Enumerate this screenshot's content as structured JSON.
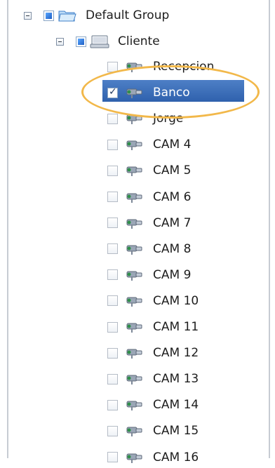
{
  "tree": {
    "root": {
      "label": "Default Group",
      "expander": "collapse-box",
      "icon": "folder-icon"
    },
    "group": {
      "label": "Cliente",
      "expander": "collapse-box",
      "icon": "computer-icon"
    },
    "cameras": [
      {
        "label": "Recepcion",
        "checked": false
      },
      {
        "label": "Banco",
        "checked": true,
        "selected": true
      },
      {
        "label": "Jorge",
        "checked": false
      },
      {
        "label": "CAM 4",
        "checked": false
      },
      {
        "label": "CAM 5",
        "checked": false
      },
      {
        "label": "CAM 6",
        "checked": false
      },
      {
        "label": "CAM 7",
        "checked": false
      },
      {
        "label": "CAM 8",
        "checked": false
      },
      {
        "label": "CAM 9",
        "checked": false
      },
      {
        "label": "CAM 10",
        "checked": false
      },
      {
        "label": "CAM 11",
        "checked": false
      },
      {
        "label": "CAM 12",
        "checked": false
      },
      {
        "label": "CAM 13",
        "checked": false
      },
      {
        "label": "CAM 14",
        "checked": false
      },
      {
        "label": "CAM 15",
        "checked": false
      },
      {
        "label": "CAM 16",
        "checked": false
      }
    ]
  },
  "highlight": {
    "color": "#f2b84a",
    "target": "Banco"
  },
  "colors": {
    "selection": "#3a6db7",
    "accent": "#1f5fc4"
  }
}
